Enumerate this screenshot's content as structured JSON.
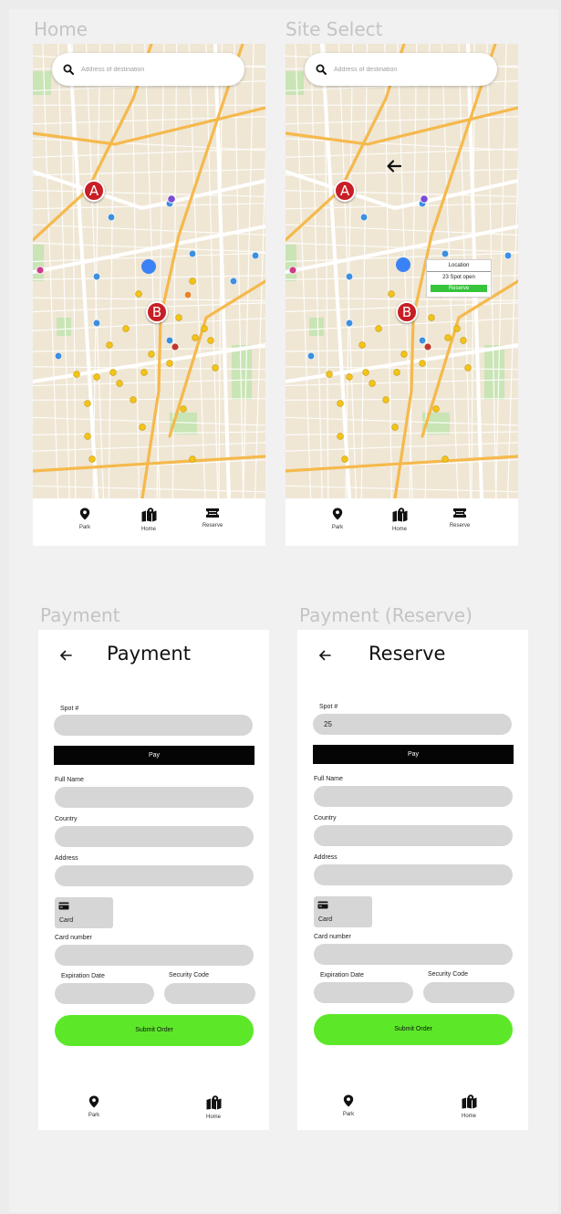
{
  "frames": {
    "home": "Home",
    "site_select": "Site Select",
    "payment": "Payment",
    "payment_reserve": "Payment (Reserve)"
  },
  "map": {
    "search_placeholder": "Address of destination",
    "marker_a": "A",
    "marker_b": "B",
    "popup": {
      "location": "Location",
      "open": "23 Spot open",
      "reserve": "Reserve"
    }
  },
  "home_nav": [
    {
      "label": "Park",
      "icon": "map-pin-icon"
    },
    {
      "label": "Home",
      "icon": "map-icon"
    },
    {
      "label": "Reserve",
      "icon": "ticket-icon"
    }
  ],
  "site_nav": [
    {
      "label": "Park",
      "icon": "map-pin-icon"
    },
    {
      "label": "Home",
      "icon": "map-icon"
    },
    {
      "label": "Reserve",
      "icon": "ticket-icon"
    }
  ],
  "payment": {
    "title": "Payment",
    "spot_label": "Spot #",
    "spot_value": "",
    "pay_label": "Pay",
    "full_name_label": "Full Name",
    "country_label": "Country",
    "address_label": "Address",
    "card_label": "Card",
    "card_number_label": "Card number",
    "expiration_label": "Expiration Date",
    "security_label": "Security Code",
    "submit_label": "Submit Order"
  },
  "reserve": {
    "title": "Reserve",
    "spot_label": "Spot #",
    "spot_value": "25",
    "pay_label": "Pay",
    "full_name_label": "Full Name",
    "country_label": "Country",
    "address_label": "Address",
    "card_label": "Card",
    "card_number_label": "Card number",
    "expiration_label": "Expiration Date",
    "security_label": "Security Code",
    "submit_label": "Submit Order"
  },
  "payment_nav": [
    {
      "label": "Park",
      "icon": "map-pin-icon"
    },
    {
      "label": "Home",
      "icon": "map-icon"
    }
  ],
  "reserve_nav": [
    {
      "label": "Park",
      "icon": "map-pin-icon"
    },
    {
      "label": "Home",
      "icon": "map-icon"
    }
  ],
  "colors": {
    "marker_red": "#c81e25",
    "user_blue": "#3b82f6",
    "submit_green": "#5ce829",
    "reserve_green": "#35c43a",
    "pill_gray": "#d6d6d6",
    "pay_black": "#050505"
  }
}
